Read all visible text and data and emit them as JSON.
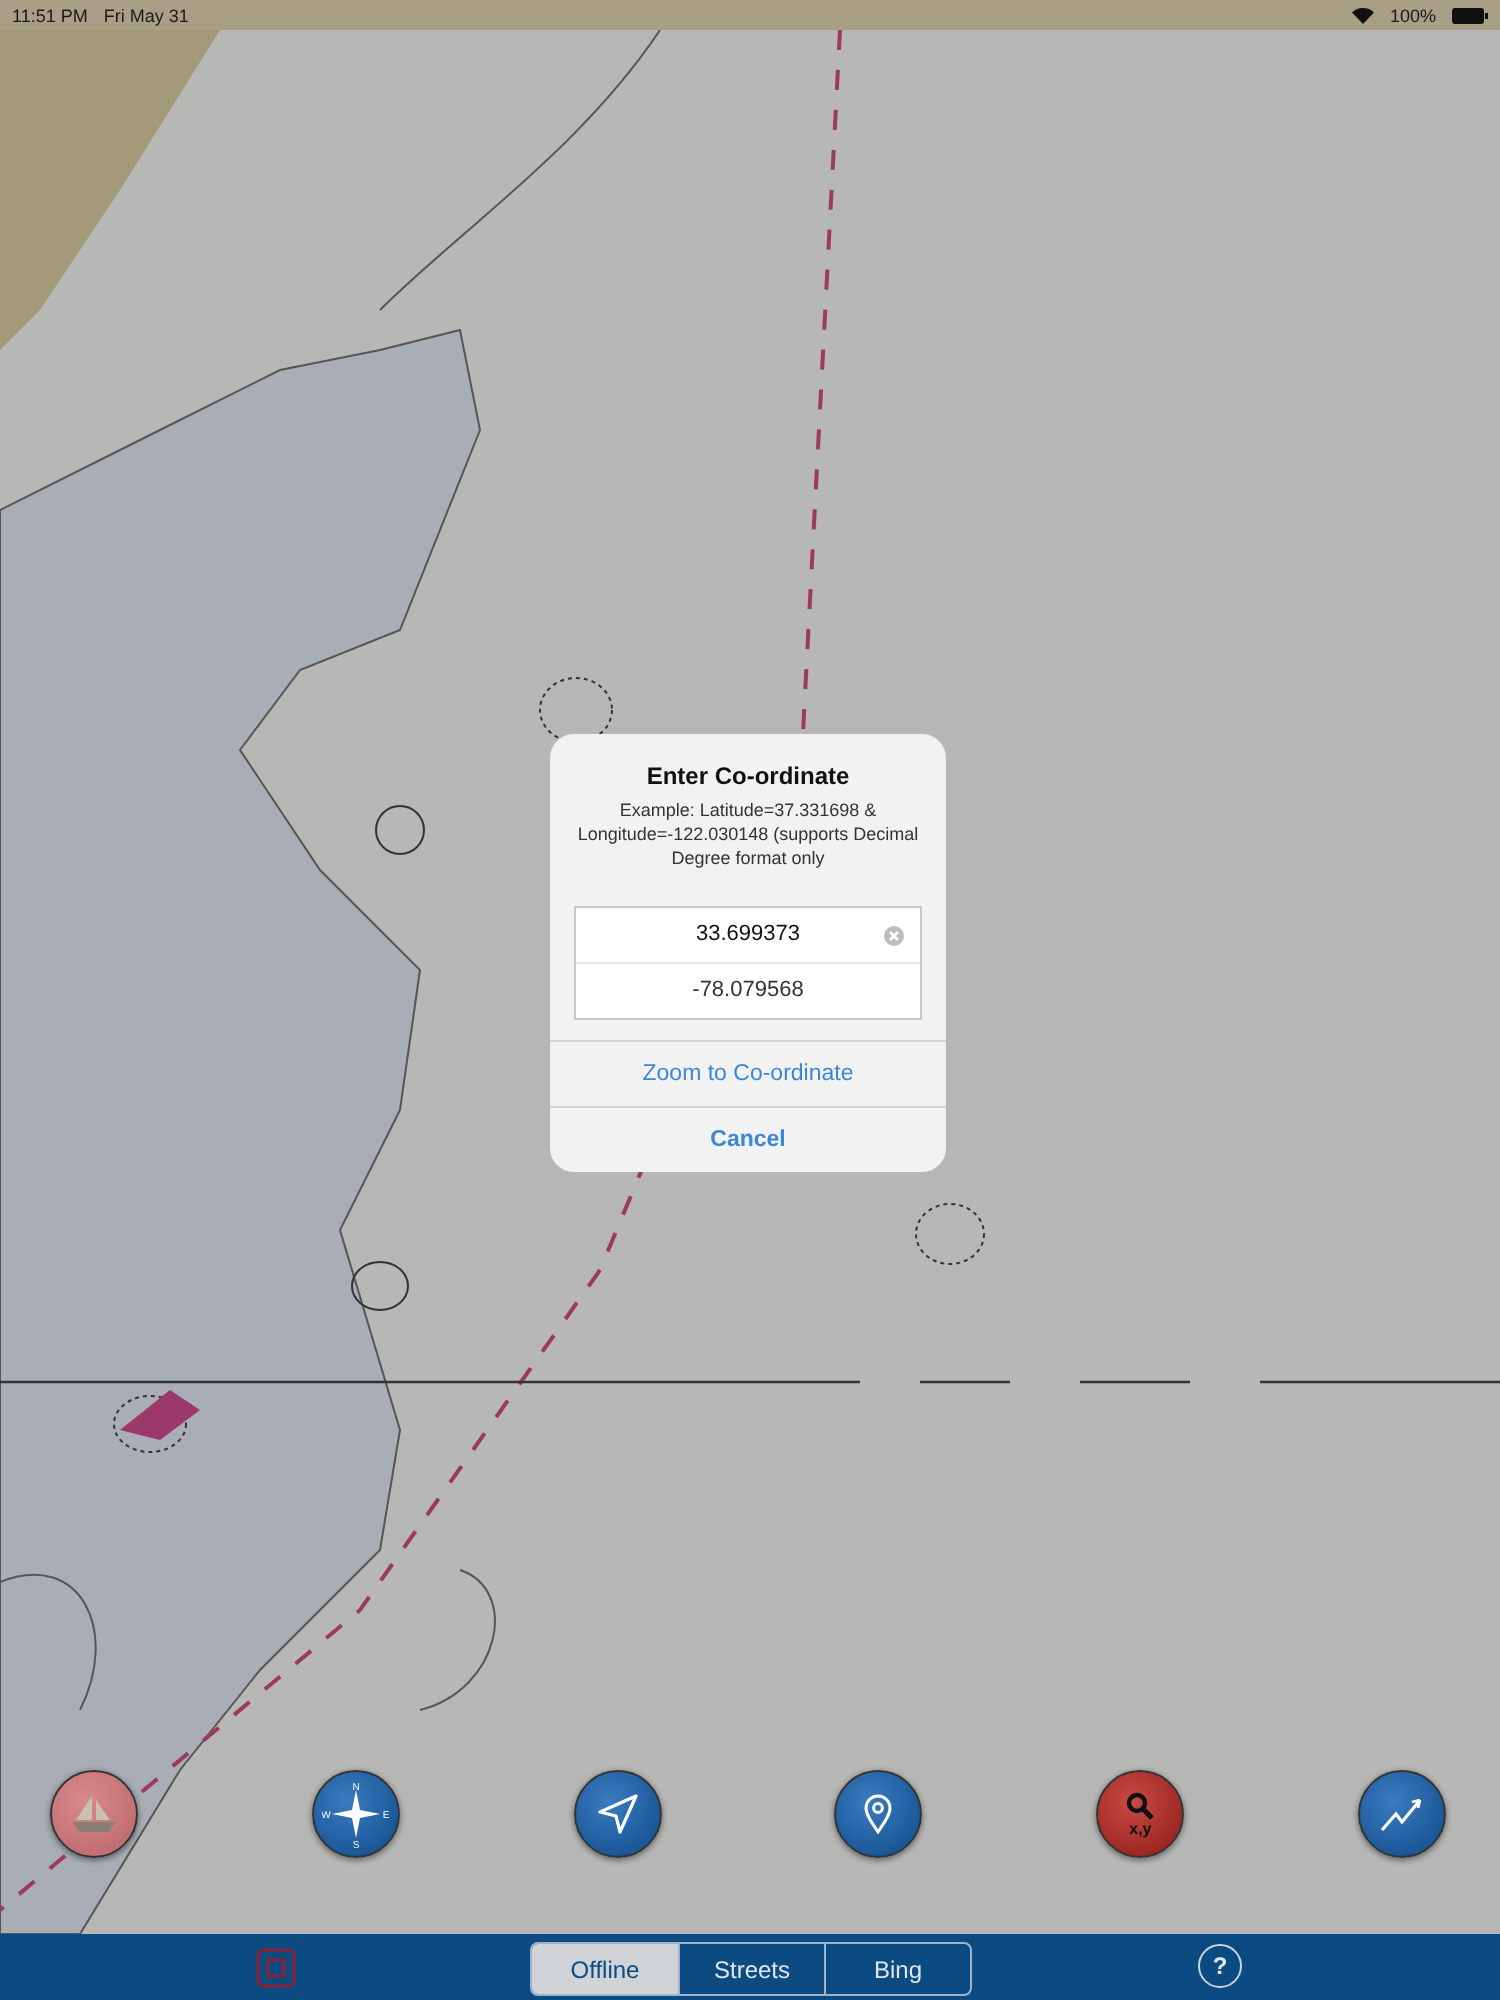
{
  "status_bar": {
    "time": "11:51 PM",
    "date": "Fri May 31",
    "battery": "100%"
  },
  "dialog": {
    "title": "Enter Co-ordinate",
    "message": "Example: Latitude=37.331698 & Longitude=-122.030148 (supports Decimal Degree format only",
    "fields": [
      {
        "value": "33.699373",
        "focused": true
      },
      {
        "value": "-78.079568",
        "focused": false
      }
    ],
    "actions": [
      {
        "label": "Zoom to Co-ordinate",
        "kind": "default"
      },
      {
        "label": "Cancel",
        "kind": "cancel"
      }
    ]
  },
  "map_tools": [
    {
      "kind": "boat",
      "active": false
    },
    {
      "kind": "compass",
      "active": false,
      "letters": [
        "N",
        "E",
        "S",
        "W"
      ]
    },
    {
      "kind": "navigate",
      "active": false
    },
    {
      "kind": "pin",
      "active": false
    },
    {
      "kind": "coordinate-search",
      "active": true,
      "label": "x,y"
    },
    {
      "kind": "route",
      "active": false
    }
  ],
  "bottom_bar": {
    "segments": [
      {
        "label": "Offline",
        "selected": true
      },
      {
        "label": "Streets",
        "selected": false
      },
      {
        "label": "Bing",
        "selected": false
      }
    ],
    "help": "?"
  }
}
